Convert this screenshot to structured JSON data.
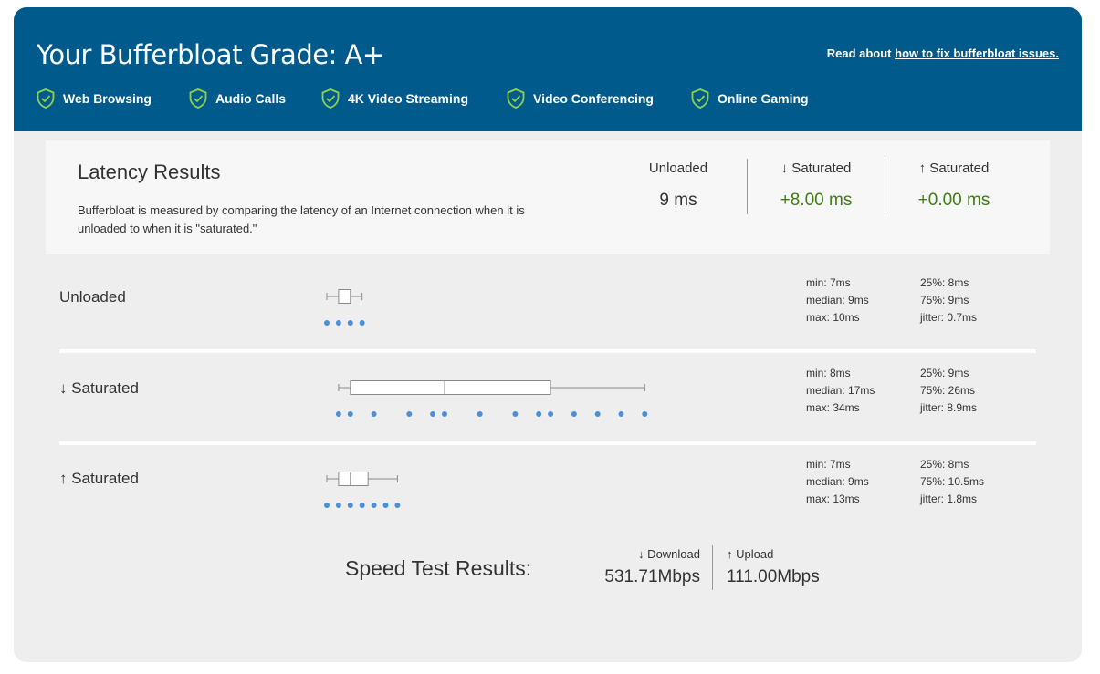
{
  "header": {
    "title": "Your Bufferbloat Grade: A+",
    "read_prefix": "Read about",
    "read_link": "how to fix bufferbloat issues.",
    "checks": [
      "Web Browsing",
      "Audio Calls",
      "4K Video Streaming",
      "Video Conferencing",
      "Online Gaming"
    ]
  },
  "latency": {
    "title": "Latency Results",
    "description": "Bufferbloat is measured by comparing the latency of an Internet connection when it is unloaded to when it is \"saturated.\"",
    "stats": [
      {
        "label": "Unloaded",
        "value": "9 ms"
      },
      {
        "label": "↓ Saturated",
        "value": "+8.00 ms"
      },
      {
        "label": "↑ Saturated",
        "value": "+0.00 ms"
      }
    ]
  },
  "rows": [
    {
      "label": "Unloaded",
      "box": {
        "min": 7,
        "q1": 8,
        "median": 9,
        "q3": 9,
        "max": 10
      },
      "points": [
        7,
        8,
        9,
        10
      ],
      "stats_left": [
        "min: 7ms",
        "median: 9ms",
        "max: 10ms"
      ],
      "stats_right": [
        "25%: 8ms",
        "75%: 9ms",
        "jitter: 0.7ms"
      ]
    },
    {
      "label": "↓ Saturated",
      "box": {
        "min": 8,
        "q1": 9,
        "median": 17,
        "q3": 26,
        "max": 34
      },
      "points": [
        8,
        9,
        11,
        14,
        16,
        17,
        20,
        23,
        25,
        26,
        28,
        30,
        32,
        34
      ],
      "stats_left": [
        "min: 8ms",
        "median: 17ms",
        "max: 34ms"
      ],
      "stats_right": [
        "25%: 9ms",
        "75%: 26ms",
        "jitter: 8.9ms"
      ]
    },
    {
      "label": "↑ Saturated",
      "box": {
        "min": 7,
        "q1": 8,
        "median": 9,
        "q3": 10.5,
        "max": 13
      },
      "points": [
        7,
        8,
        9,
        10,
        11,
        12,
        13
      ],
      "stats_left": [
        "min: 7ms",
        "median: 9ms",
        "max: 13ms"
      ],
      "stats_right": [
        "25%: 8ms",
        "75%: 10.5ms",
        "jitter: 1.8ms"
      ]
    }
  ],
  "speed": {
    "title": "Speed Test Results:",
    "download_label": "↓ Download",
    "download_value": "531.71Mbps",
    "upload_label": "↑ Upload",
    "upload_value": "111.00Mbps"
  },
  "colors": {
    "header_bg": "#005a8c",
    "green": "#3f7d12",
    "dot": "#4a90d9",
    "check_stroke": "#8fd14f"
  }
}
